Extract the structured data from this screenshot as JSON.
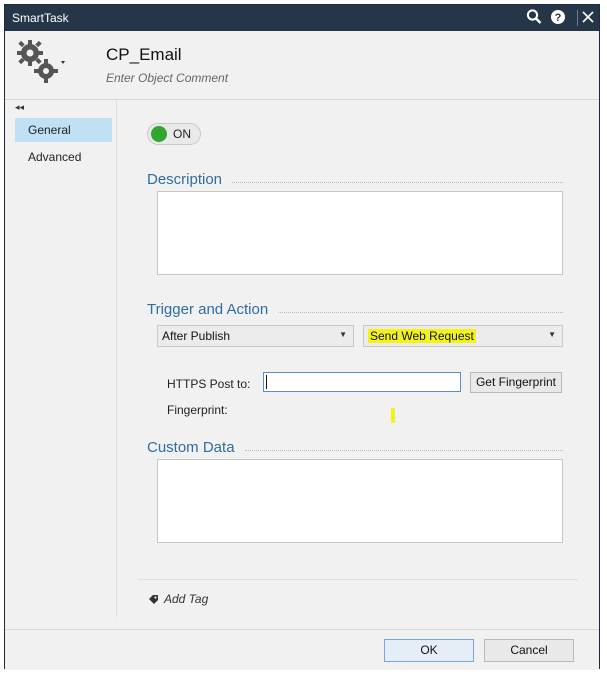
{
  "window": {
    "title": "SmartTask",
    "search_icon": "search-icon",
    "help_icon": "help-icon",
    "close_icon": "close-icon"
  },
  "header": {
    "object_name": "CP_Email",
    "comment_placeholder": "Enter Object Comment",
    "icon": "gears-icon"
  },
  "sidebar": {
    "collapse_glyph": "◂◂",
    "items": [
      {
        "label": "General",
        "active": true
      },
      {
        "label": "Advanced",
        "active": false
      }
    ]
  },
  "general": {
    "toggle_label": "ON",
    "toggle_color": "#2ea82e",
    "description_heading": "Description",
    "description_value": "",
    "trigger_heading": "Trigger and Action",
    "trigger_value": "After Publish",
    "action_value": "Send Web Request",
    "https_label": "HTTPS Post to:",
    "https_value": "",
    "get_fingerprint_label": "Get Fingerprint",
    "fingerprint_label": "Fingerprint:",
    "fingerprint_value": "",
    "custom_data_heading": "Custom Data",
    "custom_data_value": "",
    "add_tag_label": "Add Tag"
  },
  "footer": {
    "ok_label": "OK",
    "cancel_label": "Cancel"
  },
  "colors": {
    "titlebar": "#263649",
    "accent_heading": "#2e6da4",
    "highlight": "#f4f414",
    "selected_nav": "#bfe0f5"
  }
}
